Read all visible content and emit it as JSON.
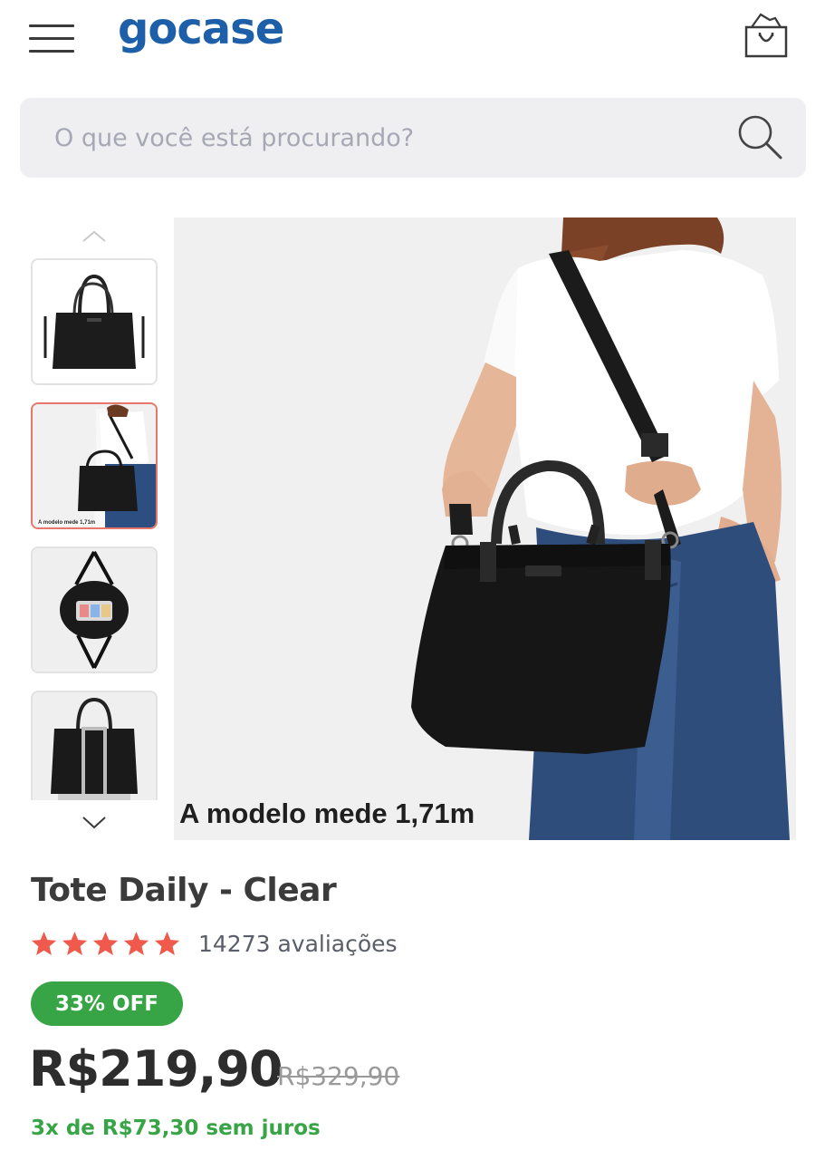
{
  "header": {
    "logo_text": "gocase",
    "logo_color": "#1d5fa8",
    "menu_icon": "hamburger-menu-icon",
    "cart_icon": "shopping-bag-icon"
  },
  "search": {
    "placeholder": "O que você está procurando?",
    "value": "",
    "icon": "search-icon"
  },
  "gallery": {
    "up_icon": "chevron-up-icon",
    "down_icon": "chevron-down-icon",
    "selected_index": 1,
    "thumbnails": [
      {
        "name": "bag-front"
      },
      {
        "name": "model-wearing-bag",
        "caption": "A modelo mede 1,71m"
      },
      {
        "name": "bag-open-top"
      },
      {
        "name": "bag-on-luggage"
      }
    ],
    "main_caption": "A modelo mede 1,71m"
  },
  "product": {
    "title": "Tote Daily - Clear",
    "rating": 5,
    "rating_max": 5,
    "reviews": "14273 avaliações",
    "discount_badge": "33% OFF",
    "price": "R$219,90",
    "old_price": "R$329,90",
    "installments": "3x de R$73,30 sem juros"
  },
  "colors": {
    "accent_green": "#37a445",
    "star_color": "#ef5a4c",
    "active_thumb_border": "#e8766a"
  }
}
